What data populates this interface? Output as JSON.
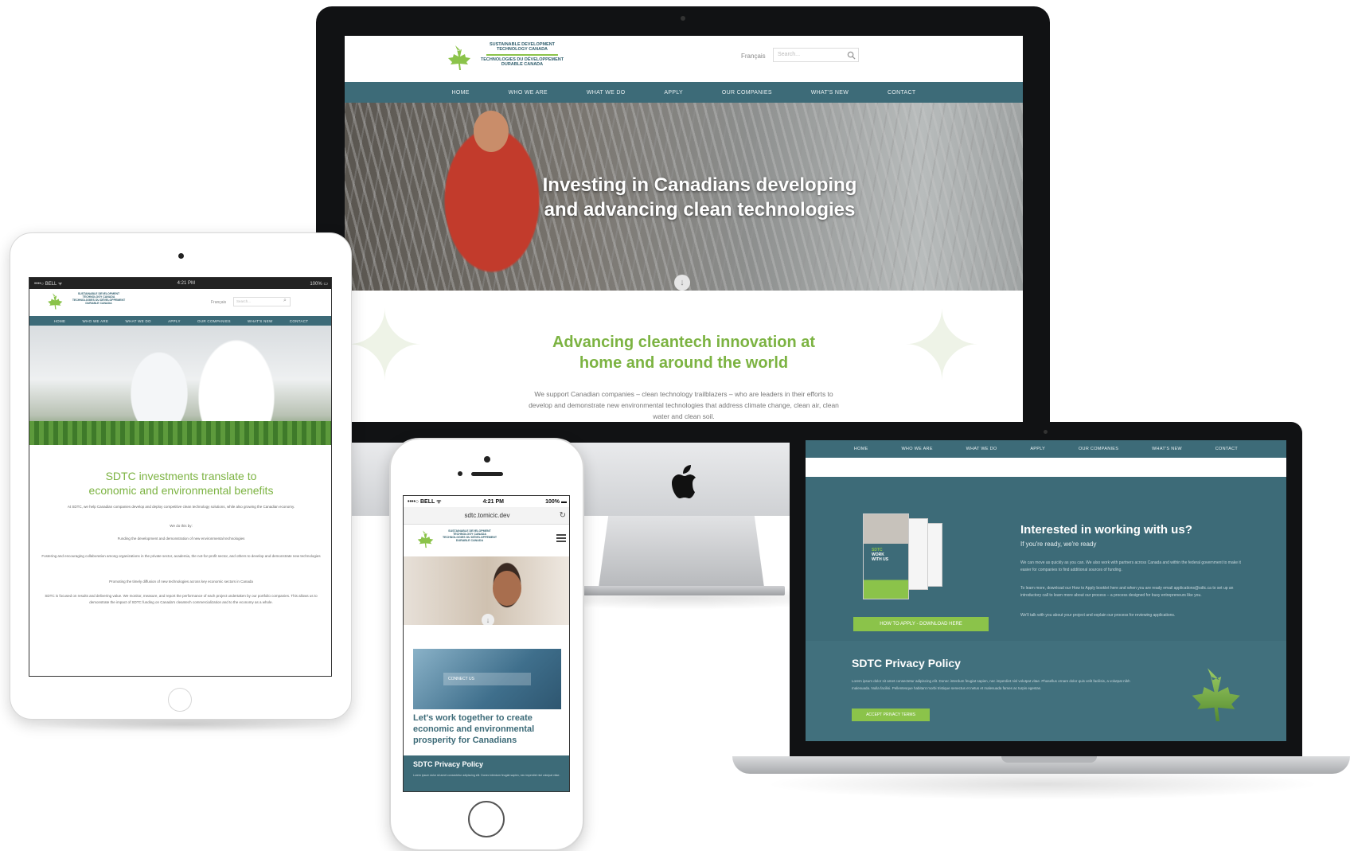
{
  "site": {
    "logo_en_line1": "SUSTAINABLE DEVELOPMENT",
    "logo_en_line2": "TECHNOLOGY CANADA",
    "logo_fr_line1": "TECHNOLOGIES DU DÉVELOPPEMENT",
    "logo_fr_line2": "DURABLE CANADA",
    "lang_link": "Français",
    "search_placeholder": "Search...",
    "nav": [
      "HOME",
      "WHO WE ARE",
      "WHAT WE DO",
      "APPLY",
      "OUR COMPANIES",
      "WHAT'S NEW",
      "CONTACT"
    ]
  },
  "imac": {
    "hero_title_line1": "Investing in Canadians developing",
    "hero_title_line2": "and advancing clean technologies",
    "main_title_line1": "Advancing cleantech innovation at",
    "main_title_line2": "home and around the world",
    "main_text": "We support Canadian companies – clean technology trailblazers – who are leaders in their efforts to develop and demonstrate new environmental technologies that address climate change, clean air, clean water and clean soil."
  },
  "ipad": {
    "status_left": "••••○ BELL ᯤ",
    "status_time": "4:21 PM",
    "status_right": "100% ▭",
    "main_title_line1": "SDTC investments translate to",
    "main_title_line2": "economic and environmental benefits",
    "p1": "At SDTC, we help Canadian companies develop and deploy competitive clean technology solutions, while also growing the Canadian economy.",
    "p2": "We do this by:",
    "p3": "Funding the development and demonstration of new environmental technologies",
    "p4": "Fostering and encouraging collaboration among organizations in the private sector, academia, the not-for-profit sector, and others to develop and demonstrate new technologies",
    "p5": "Promoting the timely diffusion of new technologies across key economic sectors in Canada",
    "p6": "SDTC is focused on results and delivering value. We monitor, measure, and report the performance of each project undertaken by our portfolio companies. This allows us to demonstrate the impact of SDTC funding on Canada's cleantech commercialization and to the economy as a whole."
  },
  "iphone": {
    "status_left": "••••○ BELL ᯤ",
    "status_time": "4:21 PM",
    "status_right": "100% ▬",
    "url": "sdtc.tomicic.dev",
    "card_bar": "CONNECT US",
    "cta_line1": "Let's work together to create",
    "cta_line2": "economic and environmental",
    "cta_line3": "prosperity for Canadians",
    "footer_title": "SDTC Privacy Policy",
    "footer_text": "Lorem ipsum dolor sit amet consectetur adipiscing elit. Donec interdum feugiat sapien, nec imperdiet nisl volutpat vitae."
  },
  "macbook": {
    "title": "Interested in working with us?",
    "subtitle": "If you're ready, we're ready",
    "p1": "We can move as quickly as you can. We also work with partners across Canada and within the federal government to make it easier for companies to find additional sources of funding.",
    "p2": "To learn more, download our How to Apply booklet here and when you are ready email applications@sdtc.ca to set up an introductory call to learn more about our process – a process designed for busy entrepreneurs like you.",
    "p3": "We'll talk with you about your project and explain our process for reviewing applications.",
    "brochure_line1": "SDTC",
    "brochure_line2": "WORK",
    "brochure_line3": "WITH US",
    "apply_button": "HOW TO APPLY - DOWNLOAD HERE",
    "privacy_title": "SDTC Privacy Policy",
    "privacy_text": "Lorem ipsum dolor sit amet consectetur adipiscing elit. Donec interdum feugiat sapien, nec imperdiet nisl volutpat vitae. Phasellus ornare dolor quis velit facilisis, a volutpat nibh malesuada. Nulla facilisi. Pellentesque habitant morbi tristique senectus et netus et malesuada fames ac turpis egestas.",
    "privacy_button": "ACCEPT PRIVACY TERMS"
  },
  "colors": {
    "brand_teal": "#3d6b78",
    "brand_green": "#7cb342"
  }
}
